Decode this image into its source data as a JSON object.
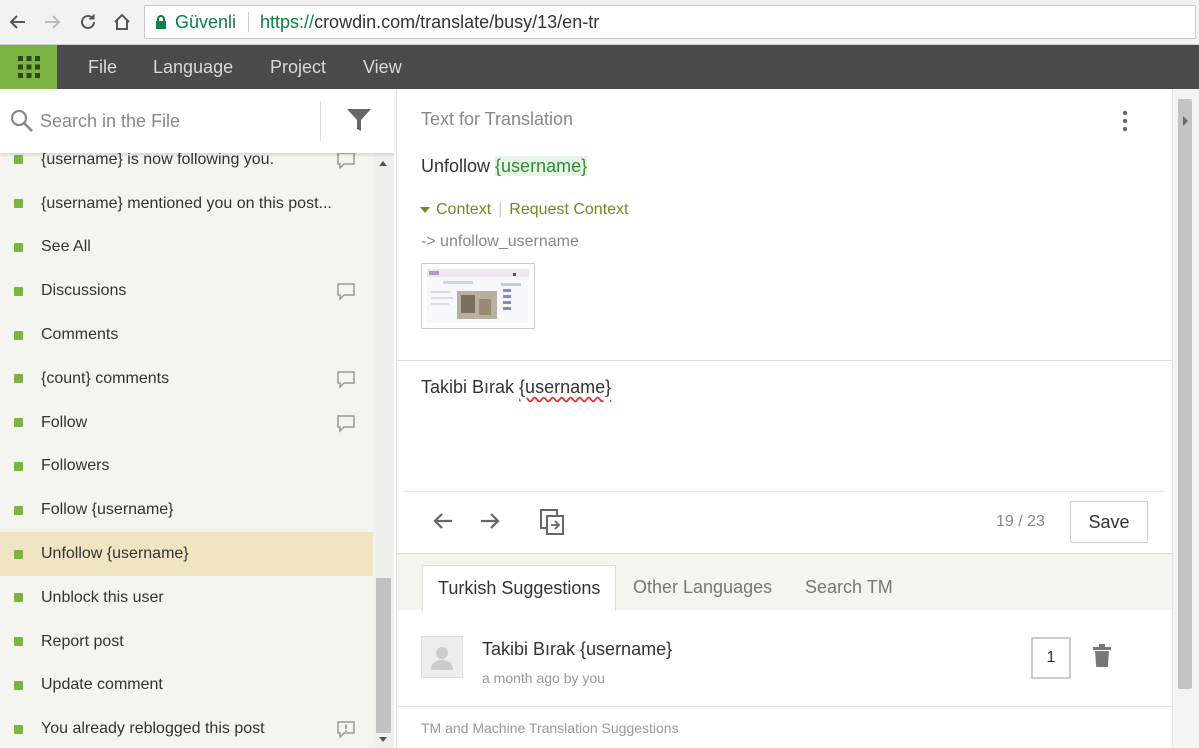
{
  "browser": {
    "secure_label": "Güvenli",
    "url_proto": "https://",
    "url_rest": "crowdin.com/translate/busy/13/en-tr"
  },
  "menu": {
    "items": [
      "File",
      "Language",
      "Project",
      "View"
    ]
  },
  "search": {
    "placeholder": "Search in the File"
  },
  "strings": [
    {
      "text": "{username} is now following you.",
      "comment": true
    },
    {
      "text": "{username} mentioned you on this post...",
      "comment": false
    },
    {
      "text": "See All",
      "comment": false
    },
    {
      "text": "Discussions",
      "comment": true
    },
    {
      "text": "Comments",
      "comment": false
    },
    {
      "text": "{count} comments",
      "comment": true
    },
    {
      "text": "Follow",
      "comment": true
    },
    {
      "text": "Followers",
      "comment": false
    },
    {
      "text": "Follow {username}",
      "comment": false
    },
    {
      "text": "Unfollow {username}",
      "comment": false,
      "active": true
    },
    {
      "text": "Unblock this user",
      "comment": false
    },
    {
      "text": "Report post",
      "comment": false
    },
    {
      "text": "Update comment",
      "comment": false
    },
    {
      "text": "You already reblogged this post",
      "comment": false,
      "issue": true
    }
  ],
  "editor": {
    "title": "Text for Translation",
    "source_prefix": "Unfollow ",
    "source_var": "{username}",
    "context_label": "Context",
    "request_context": "Request Context",
    "key": "-> unfollow_username",
    "translation_prefix": "Takibi Bırak ",
    "translation_var": "{username}",
    "counter": "19 / 23",
    "save_label": "Save"
  },
  "tabs": [
    "Turkish Suggestions",
    "Other Languages",
    "Search TM"
  ],
  "suggestion": {
    "text": "Takibi Bırak {username}",
    "meta": "a month ago by you",
    "votes": "1"
  },
  "tm_title": "TM and Machine Translation Suggestions",
  "colors": {
    "accent": "#7cb342",
    "menubar": "#4a4a4a",
    "active_row": "#f1e4c2"
  }
}
